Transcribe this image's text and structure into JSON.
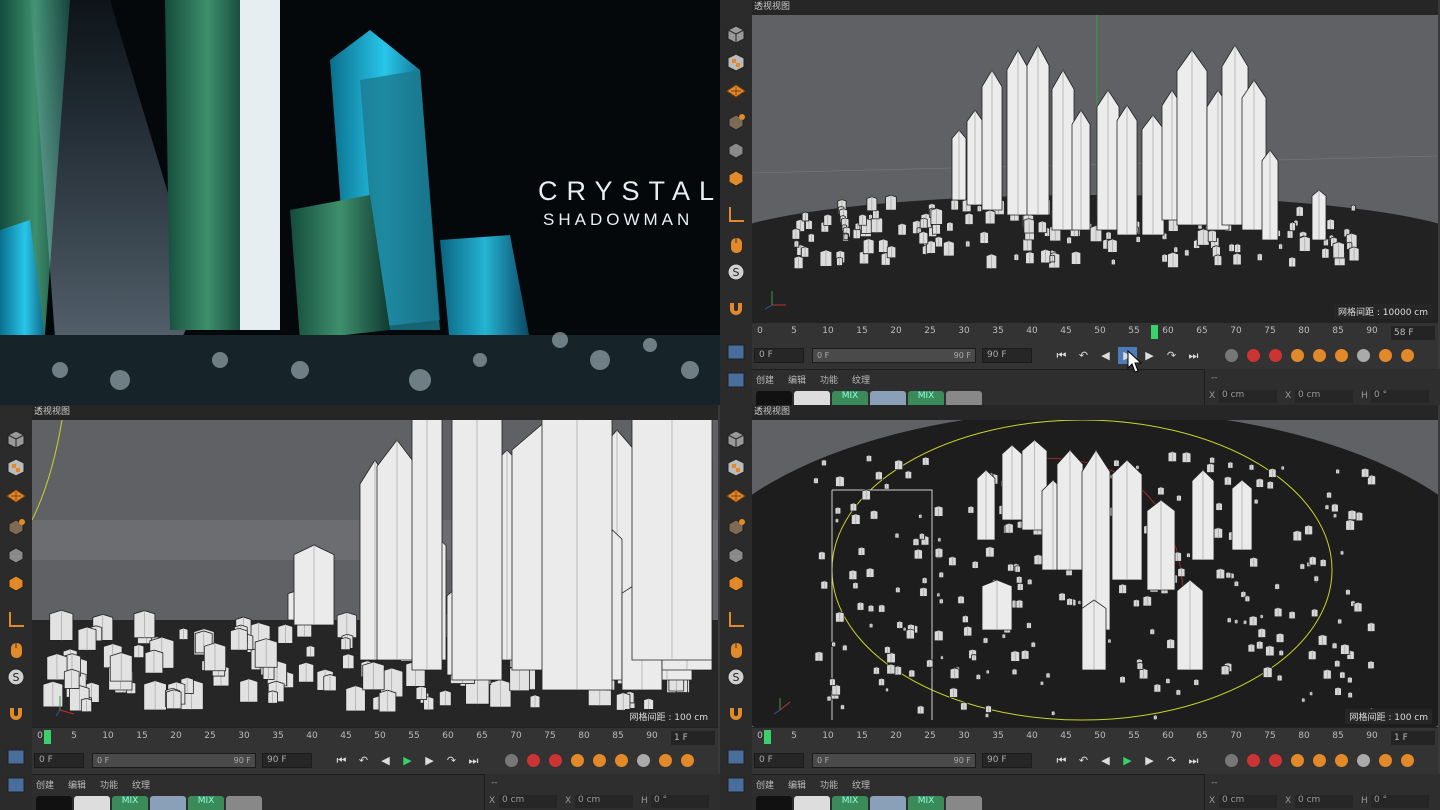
{
  "render": {
    "title": "CRYSTAL",
    "subtitle": "SHADOWMAN"
  },
  "viewports": [
    {
      "id": "tr",
      "label": "透视视图",
      "grid": "网格间距 : 10000 cm",
      "current_frame": "58 F",
      "playhead": 58
    },
    {
      "id": "bl",
      "label": "透视视图",
      "grid": "网格间距 : 100 cm",
      "current_frame": "1 F",
      "playhead": 1
    },
    {
      "id": "br",
      "label": "透视视图",
      "grid": "网格间距 : 100 cm",
      "current_frame": "1 F",
      "playhead": 1
    }
  ],
  "timeline": {
    "ticks": [
      "0",
      "5",
      "10",
      "15",
      "20",
      "25",
      "30",
      "35",
      "40",
      "45",
      "50",
      "55",
      "60",
      "65",
      "70",
      "75",
      "80",
      "85",
      "90"
    ],
    "start": "0 F",
    "slider_left": "0 F",
    "slider_right": "90 F",
    "end": "90 F"
  },
  "material_menu": {
    "items": [
      "创建",
      "编辑",
      "功能",
      "纹理"
    ],
    "balls": [
      "",
      "",
      "MIX",
      "",
      "MIX",
      ""
    ]
  },
  "attributes": {
    "header": "--",
    "x_label": "X",
    "x_val": "0 cm",
    "x2_label": "X",
    "x2_val": "0 cm",
    "h_label": "H",
    "h_val": "0 °"
  },
  "icons": {
    "cube": "cube-icon",
    "checker": "checker-icon",
    "plane": "plane-icon",
    "object": "object-mode-icon",
    "point": "points-mode-icon",
    "poly": "polygon-mode-icon",
    "axis": "axis-icon",
    "mouse": "mouse-icon",
    "snap": "snap-icon",
    "magnet": "magnet-icon"
  },
  "colors": {
    "accent": "#4d7ab8",
    "play": "#3ad06a",
    "crystal": "#e9eaec",
    "viewport_bg": "#5f6164",
    "ground": "#242424"
  }
}
